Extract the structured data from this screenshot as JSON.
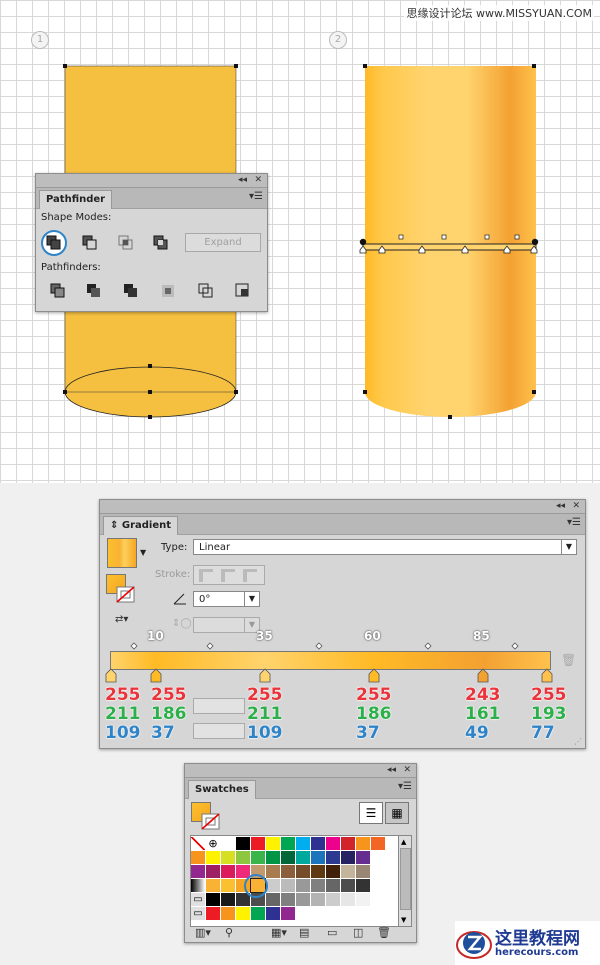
{
  "watermark_top": "思缘设计论坛 www.MISSYUAN.COM",
  "steps": [
    "1",
    "2"
  ],
  "pathfinder": {
    "title": "Pathfinder",
    "shape_modes_label": "Shape Modes:",
    "pathfinders_label": "Pathfinders:",
    "expand_label": "Expand",
    "shape_mode_icons": [
      "unite-icon",
      "minus-front-icon",
      "intersect-icon",
      "exclude-icon"
    ],
    "pathfinder_icons": [
      "divide-icon",
      "trim-icon",
      "merge-icon",
      "crop-icon",
      "outline-icon",
      "minus-back-icon"
    ]
  },
  "gradient": {
    "title": "Gradient",
    "type_label": "Type:",
    "type_value": "Linear",
    "stroke_label": "Stroke:",
    "angle_value": "0°",
    "location_labels": [
      "10",
      "35",
      "60",
      "85"
    ],
    "stops": [
      {
        "r": "255",
        "g": "211",
        "b": "109"
      },
      {
        "r": "255",
        "g": "186",
        "b": "37"
      },
      {
        "r": "255",
        "g": "211",
        "b": "109"
      },
      {
        "r": "255",
        "g": "186",
        "b": "37"
      },
      {
        "r": "243",
        "g": "161",
        "b": "49"
      },
      {
        "r": "255",
        "g": "193",
        "b": "77"
      }
    ],
    "stop_colors": [
      "#FFD36D",
      "#FFBA25",
      "#FFD36D",
      "#FFBA25",
      "#F3A131",
      "#FFC14D"
    ]
  },
  "swatches": {
    "title": "Swatches"
  },
  "watermark_bottom": {
    "title": "这里教程网",
    "url": "herecours.com"
  }
}
